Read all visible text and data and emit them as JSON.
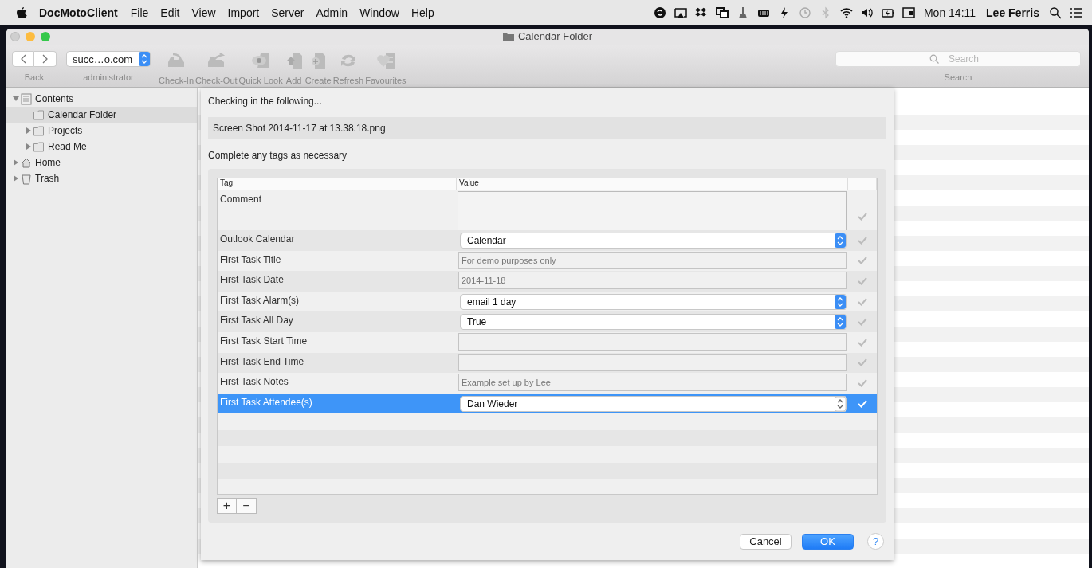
{
  "menubar": {
    "app": "DocMotoClient",
    "menus": [
      "File",
      "Edit",
      "View",
      "Import",
      "Server",
      "Admin",
      "Window",
      "Help"
    ],
    "clock": "Mon 14:11",
    "user": "Lee Ferris"
  },
  "window": {
    "title": "Calendar Folder"
  },
  "toolbar": {
    "back_label": "Back",
    "server": {
      "value": "succ…o.com",
      "label": "administrator"
    },
    "buttons": [
      {
        "label": "Check-In"
      },
      {
        "label": "Check-Out"
      },
      {
        "label": "Quick Look"
      },
      {
        "label": "Add"
      },
      {
        "label": "Create"
      },
      {
        "label": "Refresh"
      },
      {
        "label": "Favourites"
      }
    ],
    "search": {
      "placeholder": "Search",
      "label": "Search"
    }
  },
  "sidebar": {
    "items": [
      {
        "label": "Contents",
        "kind": "cabinet",
        "expanded": true,
        "selected": false,
        "children": [
          {
            "label": "Calendar Folder",
            "kind": "folder",
            "selected": true
          },
          {
            "label": "Projects",
            "kind": "folder",
            "expanded": false,
            "selected": false
          },
          {
            "label": "Read Me",
            "kind": "folder",
            "expanded": false,
            "selected": false
          }
        ]
      },
      {
        "label": "Home",
        "kind": "home",
        "expanded": false,
        "selected": false
      },
      {
        "label": "Trash",
        "kind": "trash",
        "expanded": false,
        "selected": false
      }
    ]
  },
  "sheet": {
    "heading": "Checking in the following...",
    "file": "Screen Shot 2014-11-17 at 13.38.18.png",
    "instruction": "Complete any tags as necessary",
    "table": {
      "columns": [
        "Tag",
        "Value"
      ],
      "rows": [
        {
          "tag": "Comment",
          "kind": "textarea",
          "selected": false
        },
        {
          "tag": "Outlook Calendar",
          "kind": "select",
          "value": "Calendar",
          "selected": false
        },
        {
          "tag": "First Task Title",
          "kind": "text",
          "placeholder": "For demo purposes only",
          "selected": false
        },
        {
          "tag": "First Task Date",
          "kind": "text",
          "placeholder": "2014-11-18",
          "selected": false
        },
        {
          "tag": "First Task Alarm(s)",
          "kind": "select",
          "value": "email 1 day",
          "selected": false
        },
        {
          "tag": "First Task All Day",
          "kind": "select",
          "value": "True",
          "selected": false
        },
        {
          "tag": "First Task Start Time",
          "kind": "text",
          "selected": false
        },
        {
          "tag": "First Task End Time",
          "kind": "text",
          "selected": false
        },
        {
          "tag": "First Task Notes",
          "kind": "text",
          "placeholder": "Example set up by Lee",
          "selected": false
        },
        {
          "tag": "First Task Attendee(s)",
          "kind": "select",
          "value": "Dan Wieder",
          "selected": true
        }
      ]
    },
    "add_button": "+",
    "remove_button": "−",
    "buttons": [
      {
        "label": "Cancel",
        "kind": "plain"
      },
      {
        "label": "OK",
        "kind": "default"
      }
    ],
    "help_button": "?"
  }
}
